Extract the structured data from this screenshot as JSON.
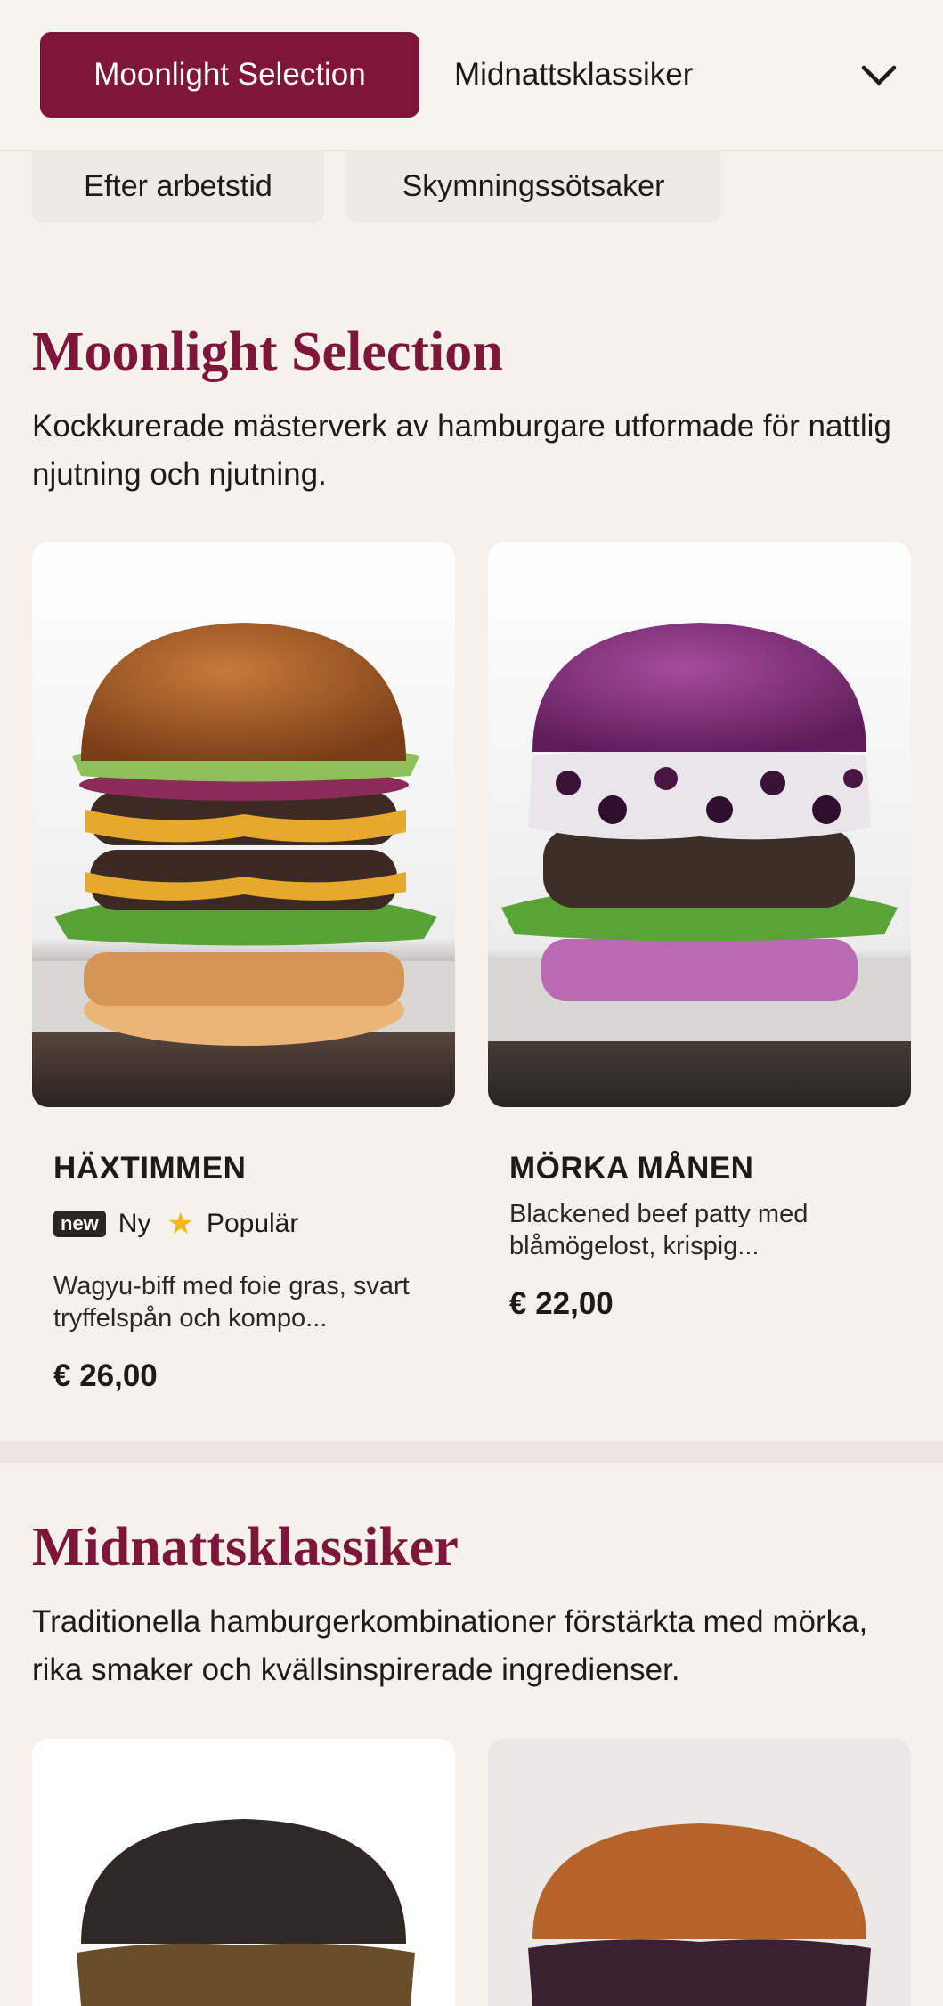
{
  "nav": {
    "active_tab": "Moonlight Selection",
    "second_tab": "Midnattsklassiker",
    "chips": [
      "Efter arbetstid",
      "Skymningssötsaker"
    ]
  },
  "sections": [
    {
      "title": "Moonlight Selection",
      "description": "Kockkurerade mästerverk av hamburgare utformade för nattlig njutning och njutning.",
      "items": [
        {
          "name": "HÄXTIMMEN",
          "badge_new": "new",
          "badge_new_label": "Ny",
          "badge_popular_label": "Populär",
          "description": "Wagyu-biff med foie gras, svart tryffelspån och kompo...",
          "price": "€ 26,00"
        },
        {
          "name": "MÖRKA MÅNEN",
          "description": "Blackened beef patty med blåmögelost, krispig...",
          "price": "€ 22,00"
        }
      ]
    },
    {
      "title": "Midnattsklassiker",
      "description": "Traditionella hamburgerkombinationer förstärkta med mörka, rika smaker och kvällsinspirerade ingredienser."
    }
  ],
  "colors": {
    "accent": "#7d1638",
    "background": "#f6f2eb",
    "star": "#f2b817"
  },
  "icons": {
    "dropdown": "chevron-down-icon",
    "popular": "star-icon"
  }
}
